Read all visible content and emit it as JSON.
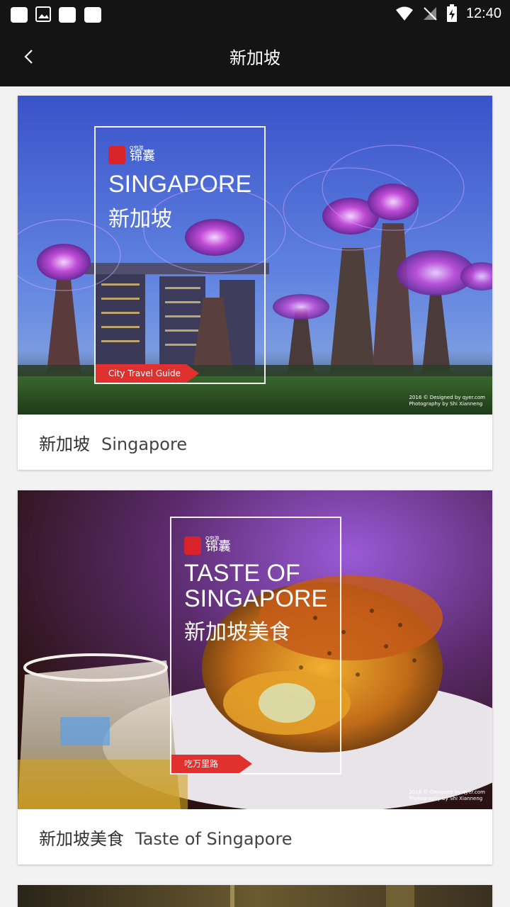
{
  "status": {
    "time": "12:40"
  },
  "appbar": {
    "title": "新加坡"
  },
  "cards": [
    {
      "title_cn": "新加坡",
      "title_en": "Singapore",
      "cover": {
        "brand": "锦囊",
        "brand_small": "Q穷游",
        "heading_en": "SINGAPORE",
        "heading_cn": "新加坡",
        "ribbon": "City Travel Guide",
        "credit_line1": "2016 © Designed by qyer.com",
        "credit_line2": "Photography by  Shi Xianneng"
      }
    },
    {
      "title_cn": "新加坡美食",
      "title_en": "Taste of Singapore",
      "cover": {
        "brand": "锦囊",
        "brand_small": "Q穷游",
        "heading_en_1": "TASTE OF",
        "heading_en_2": "SINGAPORE",
        "heading_cn": "新加坡美食",
        "ribbon": "吃万里路",
        "credit_line1": "2016 © Designed by qyer.com",
        "credit_line2": "Photography by Shi Xianneng"
      }
    }
  ],
  "colors": {
    "bar": "#141414",
    "accent": "#e1312f",
    "background": "#f2f2f2"
  }
}
